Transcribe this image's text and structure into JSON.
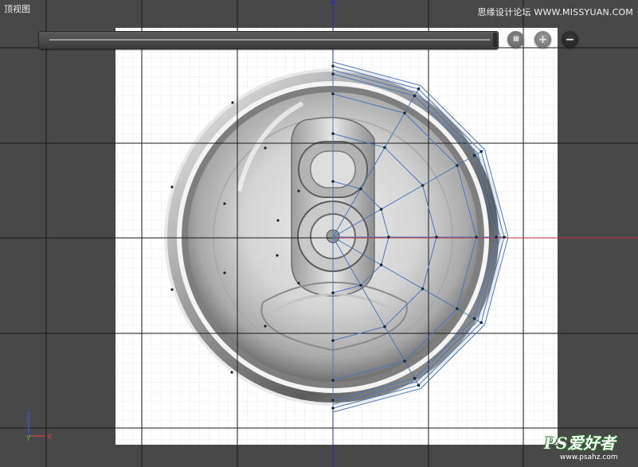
{
  "viewport": {
    "title": "顶视图",
    "watermark_top": "思缘设计论坛 WWW.MISSYUAN.COM"
  },
  "toolbar": {
    "grid_button_label": "III",
    "zoom_in_label": "+",
    "zoom_out_label": "−"
  },
  "axes": {
    "z_label": "Z",
    "y_label": "Y",
    "x_label": "X"
  },
  "watermark_bottom": {
    "brand": "PS爱好者",
    "url": "www.psahz.com"
  },
  "colors": {
    "background": "#484848",
    "canvas": "#ffffff",
    "x_axis": "#c0303a",
    "y_axis": "#2a2ad0",
    "spline": "#4a78b8",
    "grid_major": "#1a1a1a"
  }
}
